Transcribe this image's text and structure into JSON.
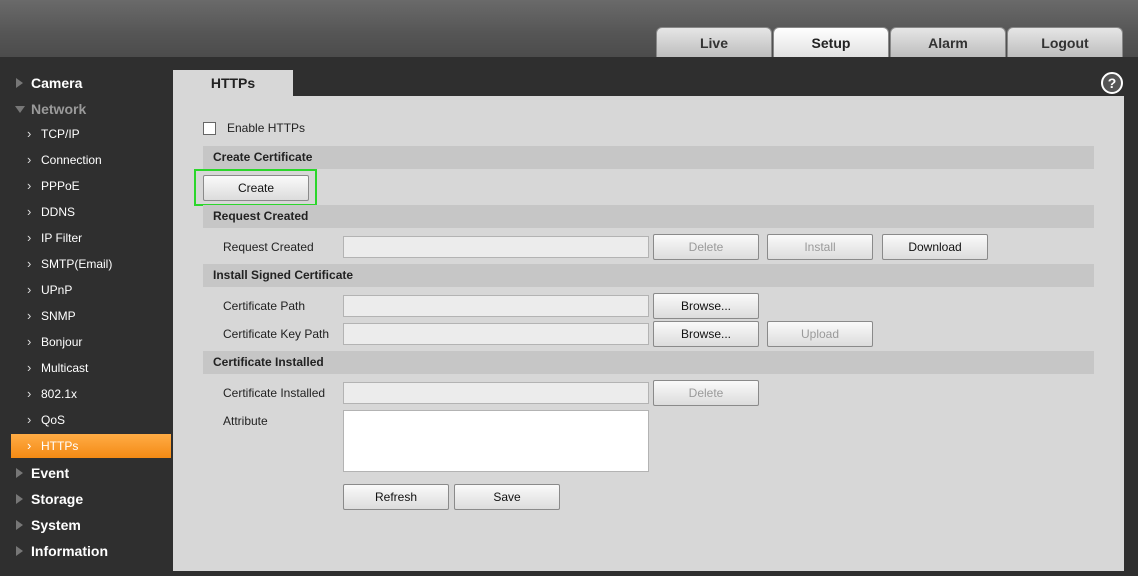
{
  "top_nav": {
    "tabs": [
      {
        "label": "Live"
      },
      {
        "label": "Setup"
      },
      {
        "label": "Alarm"
      },
      {
        "label": "Logout"
      }
    ]
  },
  "sidebar": {
    "camera": "Camera",
    "network": "Network",
    "network_items": [
      {
        "label": "TCP/IP"
      },
      {
        "label": "Connection"
      },
      {
        "label": "PPPoE"
      },
      {
        "label": "DDNS"
      },
      {
        "label": "IP Filter"
      },
      {
        "label": "SMTP(Email)"
      },
      {
        "label": "UPnP"
      },
      {
        "label": "SNMP"
      },
      {
        "label": "Bonjour"
      },
      {
        "label": "Multicast"
      },
      {
        "label": "802.1x"
      },
      {
        "label": "QoS"
      },
      {
        "label": "HTTPs"
      }
    ],
    "event": "Event",
    "storage": "Storage",
    "system": "System",
    "information": "Information"
  },
  "page": {
    "tab_title": "HTTPs",
    "help_icon": "question-circle-icon",
    "enable_label": "Enable HTTPs",
    "enable_checked": false,
    "sections": {
      "create_certificate": "Create Certificate",
      "request_created": "Request Created",
      "install_signed": "Install Signed Certificate",
      "certificate_installed": "Certificate Installed"
    },
    "labels": {
      "request_created": "Request Created",
      "certificate_path": "Certificate Path",
      "certificate_key_path": "Certificate Key Path",
      "certificate_installed": "Certificate Installed",
      "attribute": "Attribute"
    },
    "buttons": {
      "create": "Create",
      "delete": "Delete",
      "install": "Install",
      "download": "Download",
      "browse": "Browse...",
      "upload": "Upload",
      "refresh": "Refresh",
      "save": "Save"
    }
  }
}
